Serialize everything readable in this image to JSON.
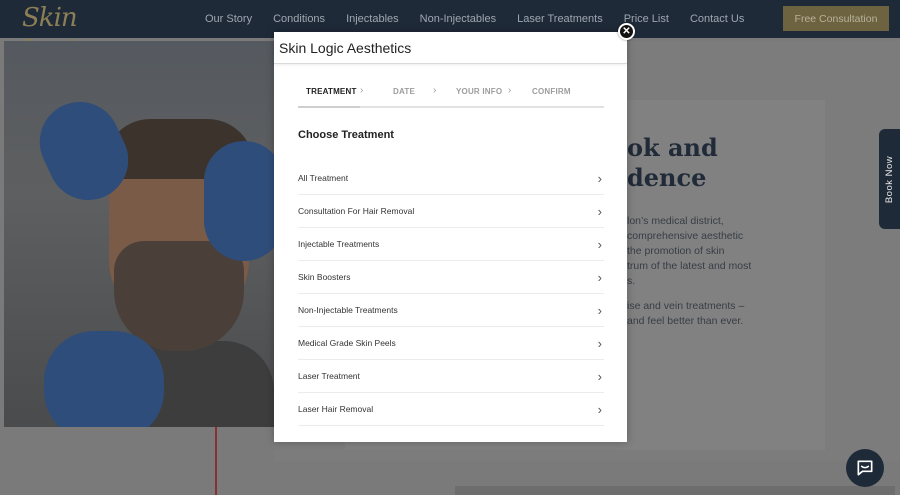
{
  "header": {
    "logo_text": "Skin Logic",
    "nav": [
      "Our Story",
      "Conditions",
      "Injectables",
      "Non-Injectables",
      "Laser Treatments",
      "Price List",
      "Contact Us"
    ],
    "cta_label": "Free Consultation"
  },
  "background": {
    "heading_lines": [
      "ok and",
      "dence"
    ],
    "para1_lines": [
      "lon’s medical district,",
      "comprehensive aesthetic",
      "the promotion of skin",
      "trum of the latest and most",
      "s."
    ],
    "para2_lines": [
      "ise and vein treatments –",
      "and feel better than ever."
    ]
  },
  "side_tab": {
    "label": "Book Now"
  },
  "modal": {
    "title": "Skin Logic Aesthetics",
    "close_label": "✕",
    "steps": [
      {
        "label": "TREATMENT",
        "active": true
      },
      {
        "label": "DATE",
        "active": false
      },
      {
        "label": "YOUR INFO",
        "active": false
      },
      {
        "label": "CONFIRM",
        "active": false
      }
    ],
    "step_separator": "›",
    "choose_heading": "Choose Treatment",
    "treatments": [
      "All Treatment",
      "Consultation For Hair Removal",
      "Injectable Treatments",
      "Skin Boosters",
      "Non-Injectable Treatments",
      "Medical Grade Skin Peels",
      "Laser Treatment",
      "Laser Hair Removal"
    ],
    "item_chevron": "›"
  },
  "colors": {
    "header_bg": "#1f2a38",
    "cta_bg": "#6e6340",
    "overlay": "#7a7a7a"
  }
}
